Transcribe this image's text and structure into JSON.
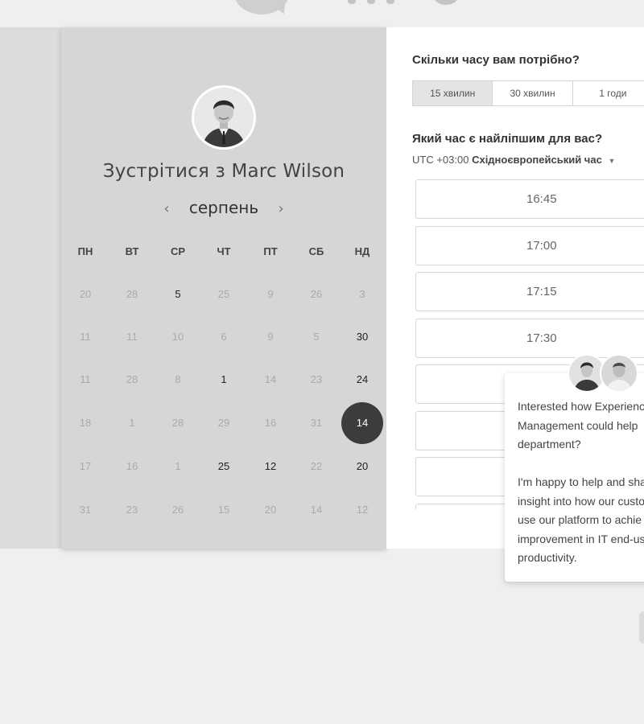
{
  "scheduler": {
    "title_prefix": "Зустрітися з",
    "host_name": "Marc Wilson",
    "month": "серпень",
    "prev_icon": "chevron-left-icon",
    "next_icon": "chevron-right-icon",
    "weekdays": [
      "ПН",
      "ВТ",
      "СР",
      "ЧТ",
      "ПТ",
      "СБ",
      "НД"
    ],
    "weeks": [
      [
        {
          "d": "20",
          "a": false
        },
        {
          "d": "28",
          "a": false
        },
        {
          "d": "5",
          "a": true
        },
        {
          "d": "25",
          "a": false
        },
        {
          "d": "9",
          "a": false
        },
        {
          "d": "26",
          "a": false
        },
        {
          "d": "3",
          "a": false
        }
      ],
      [
        {
          "d": "11",
          "a": false
        },
        {
          "d": "11",
          "a": false
        },
        {
          "d": "10",
          "a": false
        },
        {
          "d": "6",
          "a": false
        },
        {
          "d": "9",
          "a": false
        },
        {
          "d": "5",
          "a": false
        },
        {
          "d": "30",
          "a": true
        }
      ],
      [
        {
          "d": "11",
          "a": false
        },
        {
          "d": "28",
          "a": false
        },
        {
          "d": "8",
          "a": false
        },
        {
          "d": "1",
          "a": true
        },
        {
          "d": "14",
          "a": false
        },
        {
          "d": "23",
          "a": false
        },
        {
          "d": "24",
          "a": true
        }
      ],
      [
        {
          "d": "18",
          "a": false
        },
        {
          "d": "1",
          "a": false
        },
        {
          "d": "28",
          "a": false
        },
        {
          "d": "29",
          "a": false
        },
        {
          "d": "16",
          "a": false
        },
        {
          "d": "31",
          "a": false
        },
        {
          "d": "14",
          "a": true,
          "sel": true
        }
      ],
      [
        {
          "d": "17",
          "a": false
        },
        {
          "d": "16",
          "a": false
        },
        {
          "d": "1",
          "a": false
        },
        {
          "d": "25",
          "a": true
        },
        {
          "d": "12",
          "a": true
        },
        {
          "d": "22",
          "a": false
        },
        {
          "d": "20",
          "a": true
        }
      ],
      [
        {
          "d": "31",
          "a": false
        },
        {
          "d": "23",
          "a": false
        },
        {
          "d": "26",
          "a": false
        },
        {
          "d": "15",
          "a": false
        },
        {
          "d": "20",
          "a": false
        },
        {
          "d": "14",
          "a": false
        },
        {
          "d": "12",
          "a": false
        }
      ]
    ]
  },
  "booking": {
    "duration_question": "Скільки часу вам потрібно?",
    "durations": [
      {
        "label": "15 хвилин",
        "selected": true
      },
      {
        "label": "30 хвилин",
        "selected": false
      },
      {
        "label": "1 годи",
        "selected": false
      }
    ],
    "time_question": "Який час є найліпшим для вас?",
    "timezone_offset": "UTC +03:00",
    "timezone_name": "Східноєвропейський час",
    "timezone_icon": "caret-down-icon",
    "slots": [
      "16:45",
      "17:00",
      "17:15",
      "17:30",
      "",
      "",
      "",
      ""
    ]
  },
  "chat": {
    "lines": [
      "Interested how Experienc",
      "Management could help",
      "department?",
      "",
      "I'm happy to help and sha",
      "insight into how our custo",
      "use our platform to achie",
      "improvement in IT end-us",
      "productivity."
    ]
  },
  "colors": {
    "selected_day": "#3c3c3c",
    "panel": "#d6d6d6",
    "page": "#efefef"
  }
}
